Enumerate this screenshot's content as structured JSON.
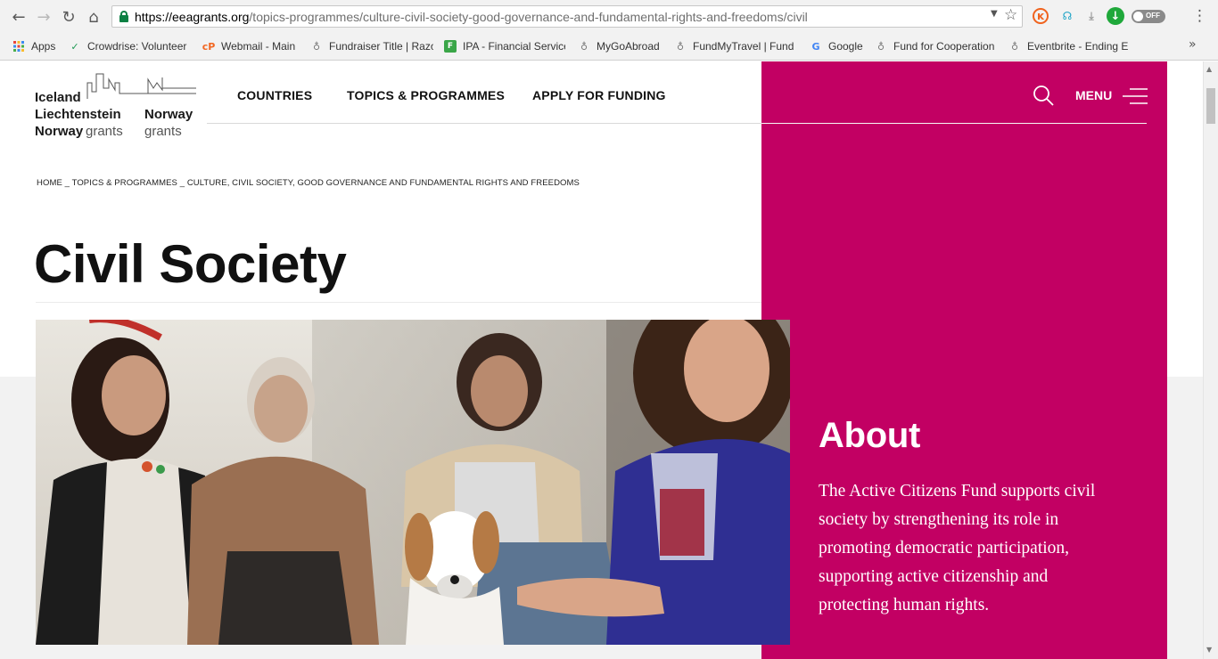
{
  "browser": {
    "url_host": "https://eeagrants.org",
    "url_path": "/topics-programmes/culture-civil-society-good-governance-and-fundamental-rights-and-freedoms/civil",
    "toggle_label": "OFF",
    "bookmarks_more": "»",
    "bookmarks": [
      {
        "label": "Apps",
        "icon": "apps-grid-icon"
      },
      {
        "label": "Crowdrise: Volunteer",
        "icon": "crowdrise-icon"
      },
      {
        "label": "Webmail - Main",
        "icon": "webmail-icon"
      },
      {
        "label": "Fundraiser Title | Razoo",
        "icon": "bookmark-globe-icon"
      },
      {
        "label": "IPA - Financial Services",
        "icon": "ipa-icon"
      },
      {
        "label": "MyGoAbroad",
        "icon": "bookmark-globe-icon"
      },
      {
        "label": "FundMyTravel | Fund",
        "icon": "bookmark-globe-icon"
      },
      {
        "label": "Google",
        "icon": "google-icon"
      },
      {
        "label": "Fund for Cooperation",
        "icon": "bookmark-globe-icon"
      },
      {
        "label": "Eventbrite - Ending E",
        "icon": "bookmark-globe-icon"
      }
    ]
  },
  "site": {
    "logo": {
      "line1": "Iceland",
      "line2": "Liechtenstein",
      "line3_bold": "Norway",
      "line3_grey": "grants",
      "right_bold": "Norway",
      "right_grey": "grants"
    },
    "nav": {
      "countries": "COUNTRIES",
      "topics": "TOPICS & PROGRAMMES",
      "apply": "APPLY FOR FUNDING",
      "menu": "MENU"
    },
    "breadcrumb": "HOME _ TOPICS & PROGRAMMES _ CULTURE, CIVIL SOCIETY, GOOD GOVERNANCE AND FUNDAMENTAL RIGHTS AND FREEDOMS",
    "title": "Civil Society",
    "about": {
      "heading": "About",
      "body": "The Active Citizens Fund supports civil society by strengthening its role in promoting democratic participation, supporting active citizenship and protecting human rights."
    }
  },
  "colors": {
    "brand_magenta": "#c20063",
    "secure_green": "#0b8043"
  }
}
